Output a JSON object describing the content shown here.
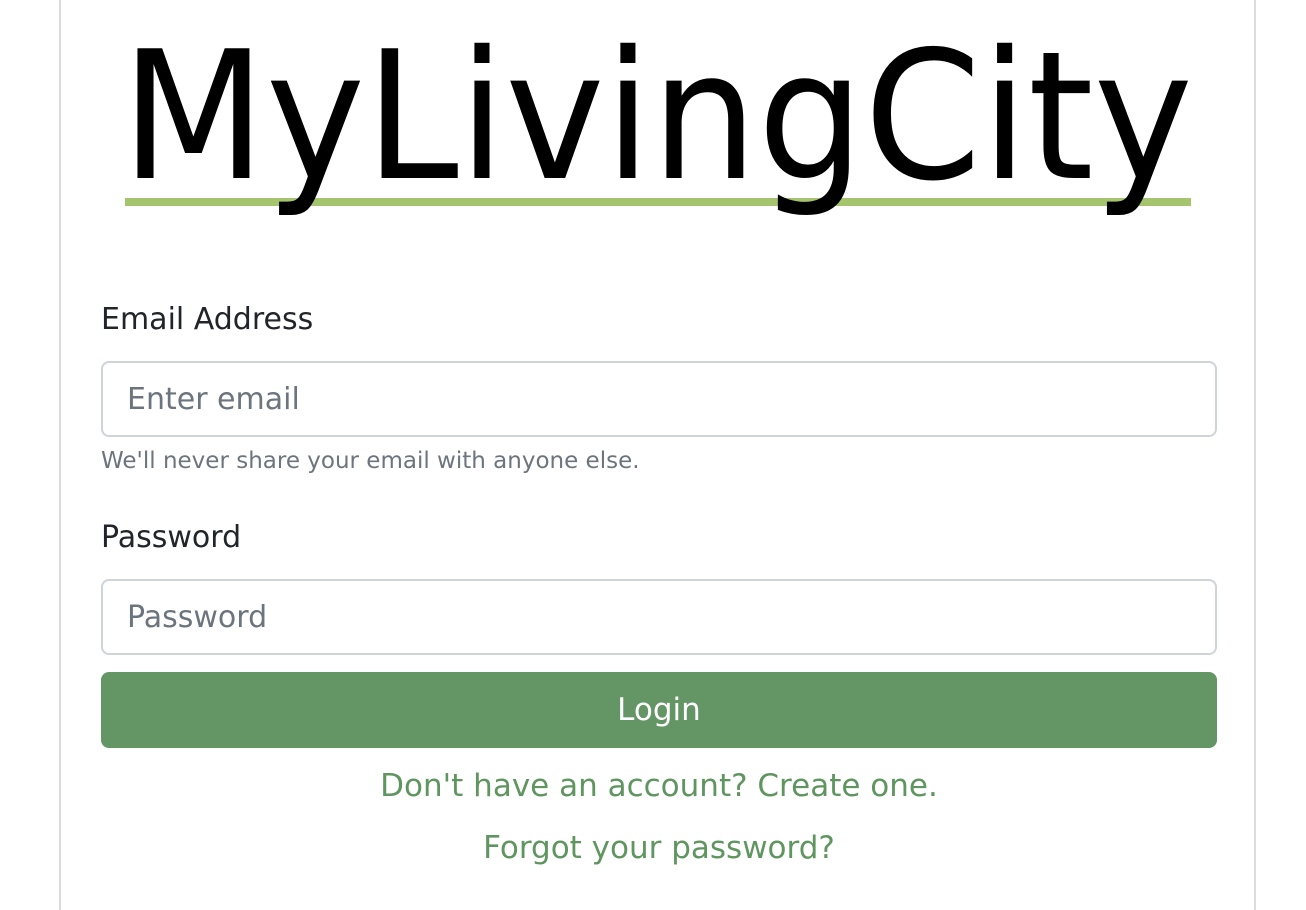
{
  "logo": {
    "text": "MyLivingCity",
    "underline_color": "#a5c46e",
    "text_color": "#000000"
  },
  "form": {
    "email_label": "Email Address",
    "email_placeholder": "Enter email",
    "email_help": "We'll never share your email with anyone else.",
    "password_label": "Password",
    "password_placeholder": "Password",
    "login_label": "Login",
    "create_account_link": "Don't have an account? Create one.",
    "forgot_password_link": "Forgot your password?"
  },
  "colors": {
    "primary": "#639565",
    "link": "#5f955f"
  }
}
